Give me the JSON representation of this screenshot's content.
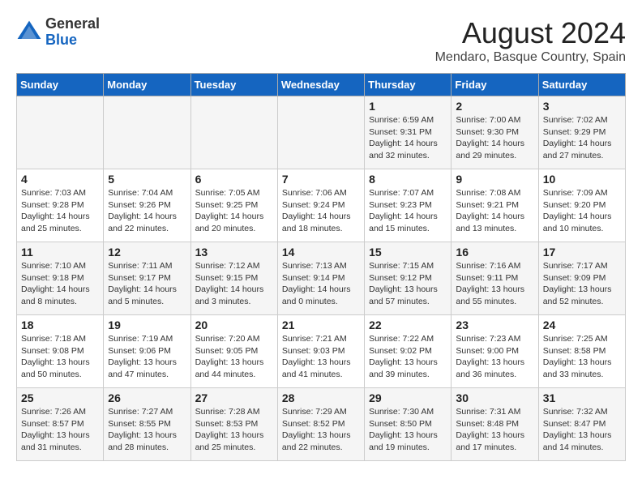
{
  "header": {
    "logo_general": "General",
    "logo_blue": "Blue",
    "month_year": "August 2024",
    "location": "Mendaro, Basque Country, Spain"
  },
  "days_of_week": [
    "Sunday",
    "Monday",
    "Tuesday",
    "Wednesday",
    "Thursday",
    "Friday",
    "Saturday"
  ],
  "weeks": [
    [
      {
        "day": "",
        "info": ""
      },
      {
        "day": "",
        "info": ""
      },
      {
        "day": "",
        "info": ""
      },
      {
        "day": "",
        "info": ""
      },
      {
        "day": "1",
        "info": "Sunrise: 6:59 AM\nSunset: 9:31 PM\nDaylight: 14 hours\nand 32 minutes."
      },
      {
        "day": "2",
        "info": "Sunrise: 7:00 AM\nSunset: 9:30 PM\nDaylight: 14 hours\nand 29 minutes."
      },
      {
        "day": "3",
        "info": "Sunrise: 7:02 AM\nSunset: 9:29 PM\nDaylight: 14 hours\nand 27 minutes."
      }
    ],
    [
      {
        "day": "4",
        "info": "Sunrise: 7:03 AM\nSunset: 9:28 PM\nDaylight: 14 hours\nand 25 minutes."
      },
      {
        "day": "5",
        "info": "Sunrise: 7:04 AM\nSunset: 9:26 PM\nDaylight: 14 hours\nand 22 minutes."
      },
      {
        "day": "6",
        "info": "Sunrise: 7:05 AM\nSunset: 9:25 PM\nDaylight: 14 hours\nand 20 minutes."
      },
      {
        "day": "7",
        "info": "Sunrise: 7:06 AM\nSunset: 9:24 PM\nDaylight: 14 hours\nand 18 minutes."
      },
      {
        "day": "8",
        "info": "Sunrise: 7:07 AM\nSunset: 9:23 PM\nDaylight: 14 hours\nand 15 minutes."
      },
      {
        "day": "9",
        "info": "Sunrise: 7:08 AM\nSunset: 9:21 PM\nDaylight: 14 hours\nand 13 minutes."
      },
      {
        "day": "10",
        "info": "Sunrise: 7:09 AM\nSunset: 9:20 PM\nDaylight: 14 hours\nand 10 minutes."
      }
    ],
    [
      {
        "day": "11",
        "info": "Sunrise: 7:10 AM\nSunset: 9:18 PM\nDaylight: 14 hours\nand 8 minutes."
      },
      {
        "day": "12",
        "info": "Sunrise: 7:11 AM\nSunset: 9:17 PM\nDaylight: 14 hours\nand 5 minutes."
      },
      {
        "day": "13",
        "info": "Sunrise: 7:12 AM\nSunset: 9:15 PM\nDaylight: 14 hours\nand 3 minutes."
      },
      {
        "day": "14",
        "info": "Sunrise: 7:13 AM\nSunset: 9:14 PM\nDaylight: 14 hours\nand 0 minutes."
      },
      {
        "day": "15",
        "info": "Sunrise: 7:15 AM\nSunset: 9:12 PM\nDaylight: 13 hours\nand 57 minutes."
      },
      {
        "day": "16",
        "info": "Sunrise: 7:16 AM\nSunset: 9:11 PM\nDaylight: 13 hours\nand 55 minutes."
      },
      {
        "day": "17",
        "info": "Sunrise: 7:17 AM\nSunset: 9:09 PM\nDaylight: 13 hours\nand 52 minutes."
      }
    ],
    [
      {
        "day": "18",
        "info": "Sunrise: 7:18 AM\nSunset: 9:08 PM\nDaylight: 13 hours\nand 50 minutes."
      },
      {
        "day": "19",
        "info": "Sunrise: 7:19 AM\nSunset: 9:06 PM\nDaylight: 13 hours\nand 47 minutes."
      },
      {
        "day": "20",
        "info": "Sunrise: 7:20 AM\nSunset: 9:05 PM\nDaylight: 13 hours\nand 44 minutes."
      },
      {
        "day": "21",
        "info": "Sunrise: 7:21 AM\nSunset: 9:03 PM\nDaylight: 13 hours\nand 41 minutes."
      },
      {
        "day": "22",
        "info": "Sunrise: 7:22 AM\nSunset: 9:02 PM\nDaylight: 13 hours\nand 39 minutes."
      },
      {
        "day": "23",
        "info": "Sunrise: 7:23 AM\nSunset: 9:00 PM\nDaylight: 13 hours\nand 36 minutes."
      },
      {
        "day": "24",
        "info": "Sunrise: 7:25 AM\nSunset: 8:58 PM\nDaylight: 13 hours\nand 33 minutes."
      }
    ],
    [
      {
        "day": "25",
        "info": "Sunrise: 7:26 AM\nSunset: 8:57 PM\nDaylight: 13 hours\nand 31 minutes."
      },
      {
        "day": "26",
        "info": "Sunrise: 7:27 AM\nSunset: 8:55 PM\nDaylight: 13 hours\nand 28 minutes."
      },
      {
        "day": "27",
        "info": "Sunrise: 7:28 AM\nSunset: 8:53 PM\nDaylight: 13 hours\nand 25 minutes."
      },
      {
        "day": "28",
        "info": "Sunrise: 7:29 AM\nSunset: 8:52 PM\nDaylight: 13 hours\nand 22 minutes."
      },
      {
        "day": "29",
        "info": "Sunrise: 7:30 AM\nSunset: 8:50 PM\nDaylight: 13 hours\nand 19 minutes."
      },
      {
        "day": "30",
        "info": "Sunrise: 7:31 AM\nSunset: 8:48 PM\nDaylight: 13 hours\nand 17 minutes."
      },
      {
        "day": "31",
        "info": "Sunrise: 7:32 AM\nSunset: 8:47 PM\nDaylight: 13 hours\nand 14 minutes."
      }
    ]
  ]
}
